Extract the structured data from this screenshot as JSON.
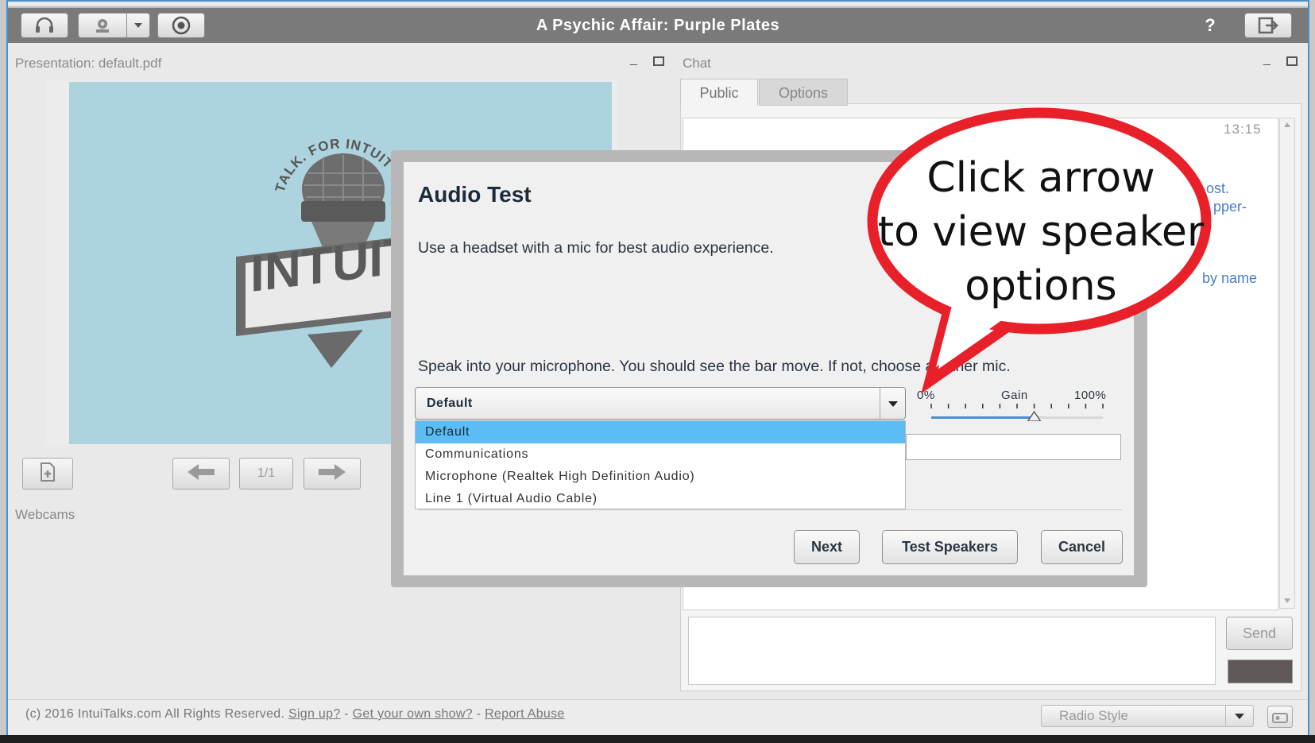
{
  "app": {
    "title": "A Psychic Affair: Purple Plates"
  },
  "topbar": {
    "headset_icon": "headset-icon",
    "webcam_icon": "webcam-icon",
    "record_icon": "record-icon",
    "help_label": "?",
    "logout_icon": "logout-icon"
  },
  "presentation": {
    "title": "Presentation: default.pdf",
    "page_indicator": "1/1",
    "slide_logo": {
      "arc_text": "TALK. FOR INTUITIVES.",
      "sign_text": "INTUITAL"
    }
  },
  "webcams": {
    "title": "Webcams"
  },
  "chat": {
    "title": "Chat",
    "tabs": [
      "Public",
      "Options"
    ],
    "timestamp": "13:15",
    "partial_lines": [
      "ost.",
      "pper-",
      "by name"
    ],
    "send_label": "Send",
    "swatch_color": "#5e5858"
  },
  "modal": {
    "title": "Audio Test",
    "headset_tip": "Use a headset with a mic for best audio experience.",
    "instruction": "Speak into your microphone. You should see the bar move. If not, choose another mic.",
    "mic_selected": "Default",
    "mic_options": [
      "Default",
      "Communications",
      "Microphone (Realtek High Definition Audio)",
      "Line 1 (Virtual Audio Cable)"
    ],
    "gain": {
      "min_label": "0%",
      "label": "Gain",
      "max_label": "100%",
      "value_percent": 60
    },
    "buttons": {
      "next": "Next",
      "test_speakers": "Test Speakers",
      "cancel": "Cancel"
    }
  },
  "callout": {
    "lines": [
      "Click arrow",
      "to view speaker",
      "options"
    ],
    "border_color": "#e8202a"
  },
  "footer": {
    "copyright": "(c) 2016 IntuiTalks.com All Rights Reserved.",
    "sign_up": "Sign up?",
    "own_show": "Get your own show?",
    "report": "Report Abuse",
    "separator": " - ",
    "radio_style": "Radio Style"
  },
  "colors": {
    "accent_select": "#5cbdf5",
    "frame_border": "#4a90c9",
    "topbar": "#7a7a7a"
  }
}
